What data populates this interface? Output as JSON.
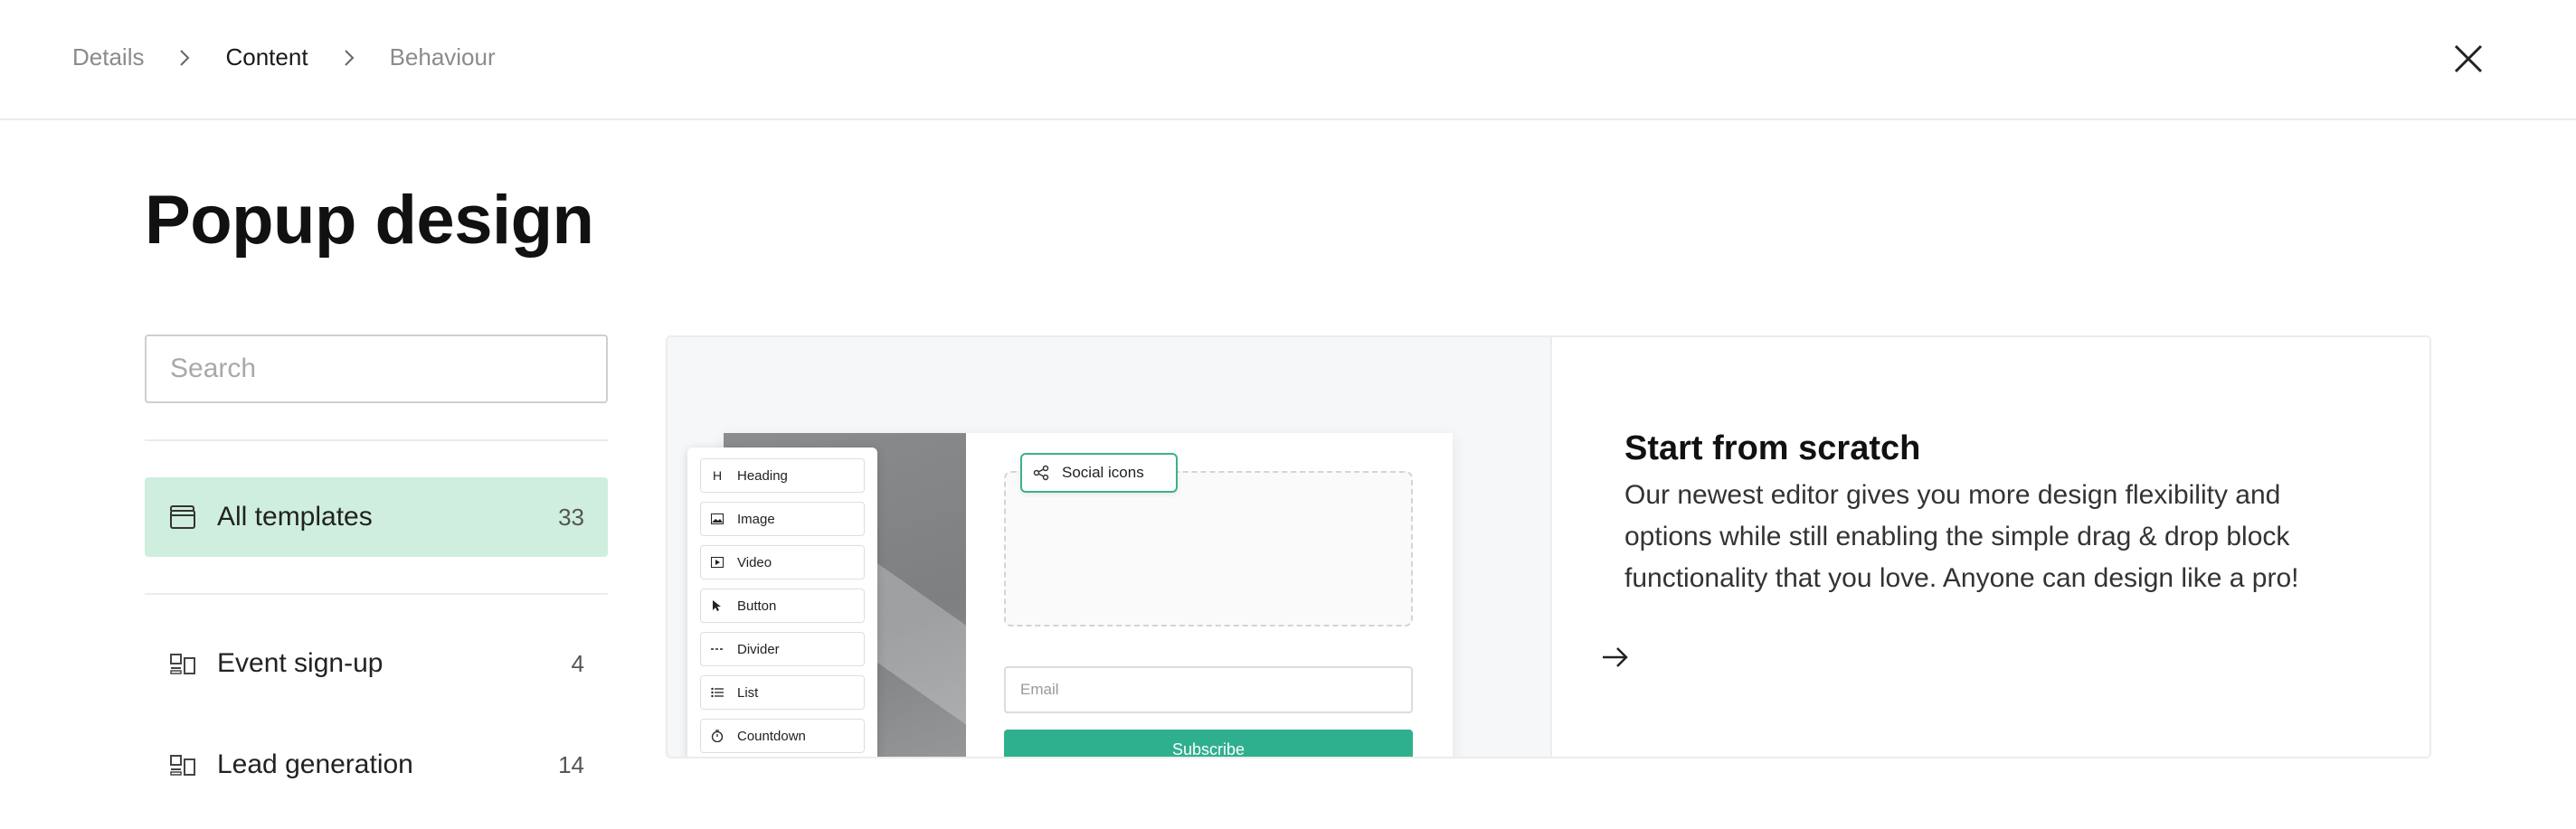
{
  "breadcrumb": {
    "items": [
      {
        "label": "Details",
        "active": false
      },
      {
        "label": "Content",
        "active": true
      },
      {
        "label": "Behaviour",
        "active": false
      }
    ]
  },
  "page": {
    "title": "Popup design"
  },
  "search": {
    "placeholder": "Search",
    "value": ""
  },
  "sidebar": {
    "items": [
      {
        "label": "All templates",
        "count": "33",
        "icon": "folder-icon",
        "active": true
      },
      {
        "label": "Event sign-up",
        "count": "4",
        "icon": "layout-icon",
        "active": false
      },
      {
        "label": "Lead generation",
        "count": "14",
        "icon": "layout-icon",
        "active": false
      }
    ]
  },
  "preview": {
    "blocks": [
      {
        "label": "Heading",
        "icon": "heading-icon"
      },
      {
        "label": "Image",
        "icon": "image-icon"
      },
      {
        "label": "Video",
        "icon": "video-icon"
      },
      {
        "label": "Button",
        "icon": "cursor-icon"
      },
      {
        "label": "Divider",
        "icon": "divider-icon"
      },
      {
        "label": "List",
        "icon": "list-icon"
      },
      {
        "label": "Countdown",
        "icon": "timer-icon"
      }
    ],
    "social_chip": "Social icons",
    "email_placeholder": "Email",
    "subscribe_label": "Subscribe"
  },
  "scratch": {
    "title": "Start from scratch",
    "description": "Our newest editor gives you more design flexibility and options while still enabling the simple drag & drop block functionality that you love. Anyone can design like a pro!"
  },
  "colors": {
    "accent": "#2eb08f",
    "active_bg": "#cfeedd",
    "border": "#ececec"
  }
}
